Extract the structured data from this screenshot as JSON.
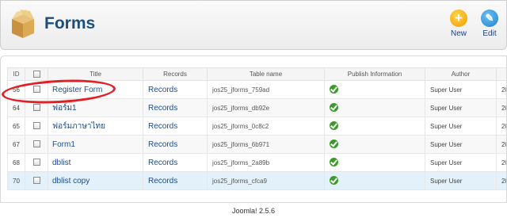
{
  "header": {
    "title": "Forms",
    "new_label": "New",
    "edit_label": "Edit"
  },
  "table": {
    "columns": {
      "id": "ID",
      "title": "Title",
      "records": "Records",
      "table_name": "Table name",
      "publish": "Publish Information",
      "author": "Author",
      "date": ""
    },
    "rows": [
      {
        "id": "56",
        "title": "Register Form",
        "records": "Records",
        "table_name": "jos25_jforms_759ad",
        "author": "Super User",
        "date": "20"
      },
      {
        "id": "64",
        "title": "ฟอร์ม1",
        "records": "Records",
        "table_name": "jos25_jforms_db92e",
        "author": "Super User",
        "date": "20"
      },
      {
        "id": "65",
        "title": "ฟอร์มภาษาไทย",
        "records": "Records",
        "table_name": "jos25_jforms_0c8c2",
        "author": "Super User",
        "date": "20"
      },
      {
        "id": "67",
        "title": "Form1",
        "records": "Records",
        "table_name": "jos25_jforms_6b971",
        "author": "Super User",
        "date": "20"
      },
      {
        "id": "68",
        "title": "dblist",
        "records": "Records",
        "table_name": "jos25_jforms_2a89b",
        "author": "Super User",
        "date": "20"
      },
      {
        "id": "70",
        "title": "dblist copy",
        "records": "Records",
        "table_name": "jos25_jforms_cfca9",
        "author": "Super User",
        "date": "20"
      }
    ]
  },
  "footer": {
    "version_text": "Joomla! 2.5.6"
  },
  "colors": {
    "title_blue": "#1e4f7a",
    "link_blue": "#1d4b8c",
    "annotation_red": "#e31f26",
    "published_green": "#3a9a2a"
  }
}
